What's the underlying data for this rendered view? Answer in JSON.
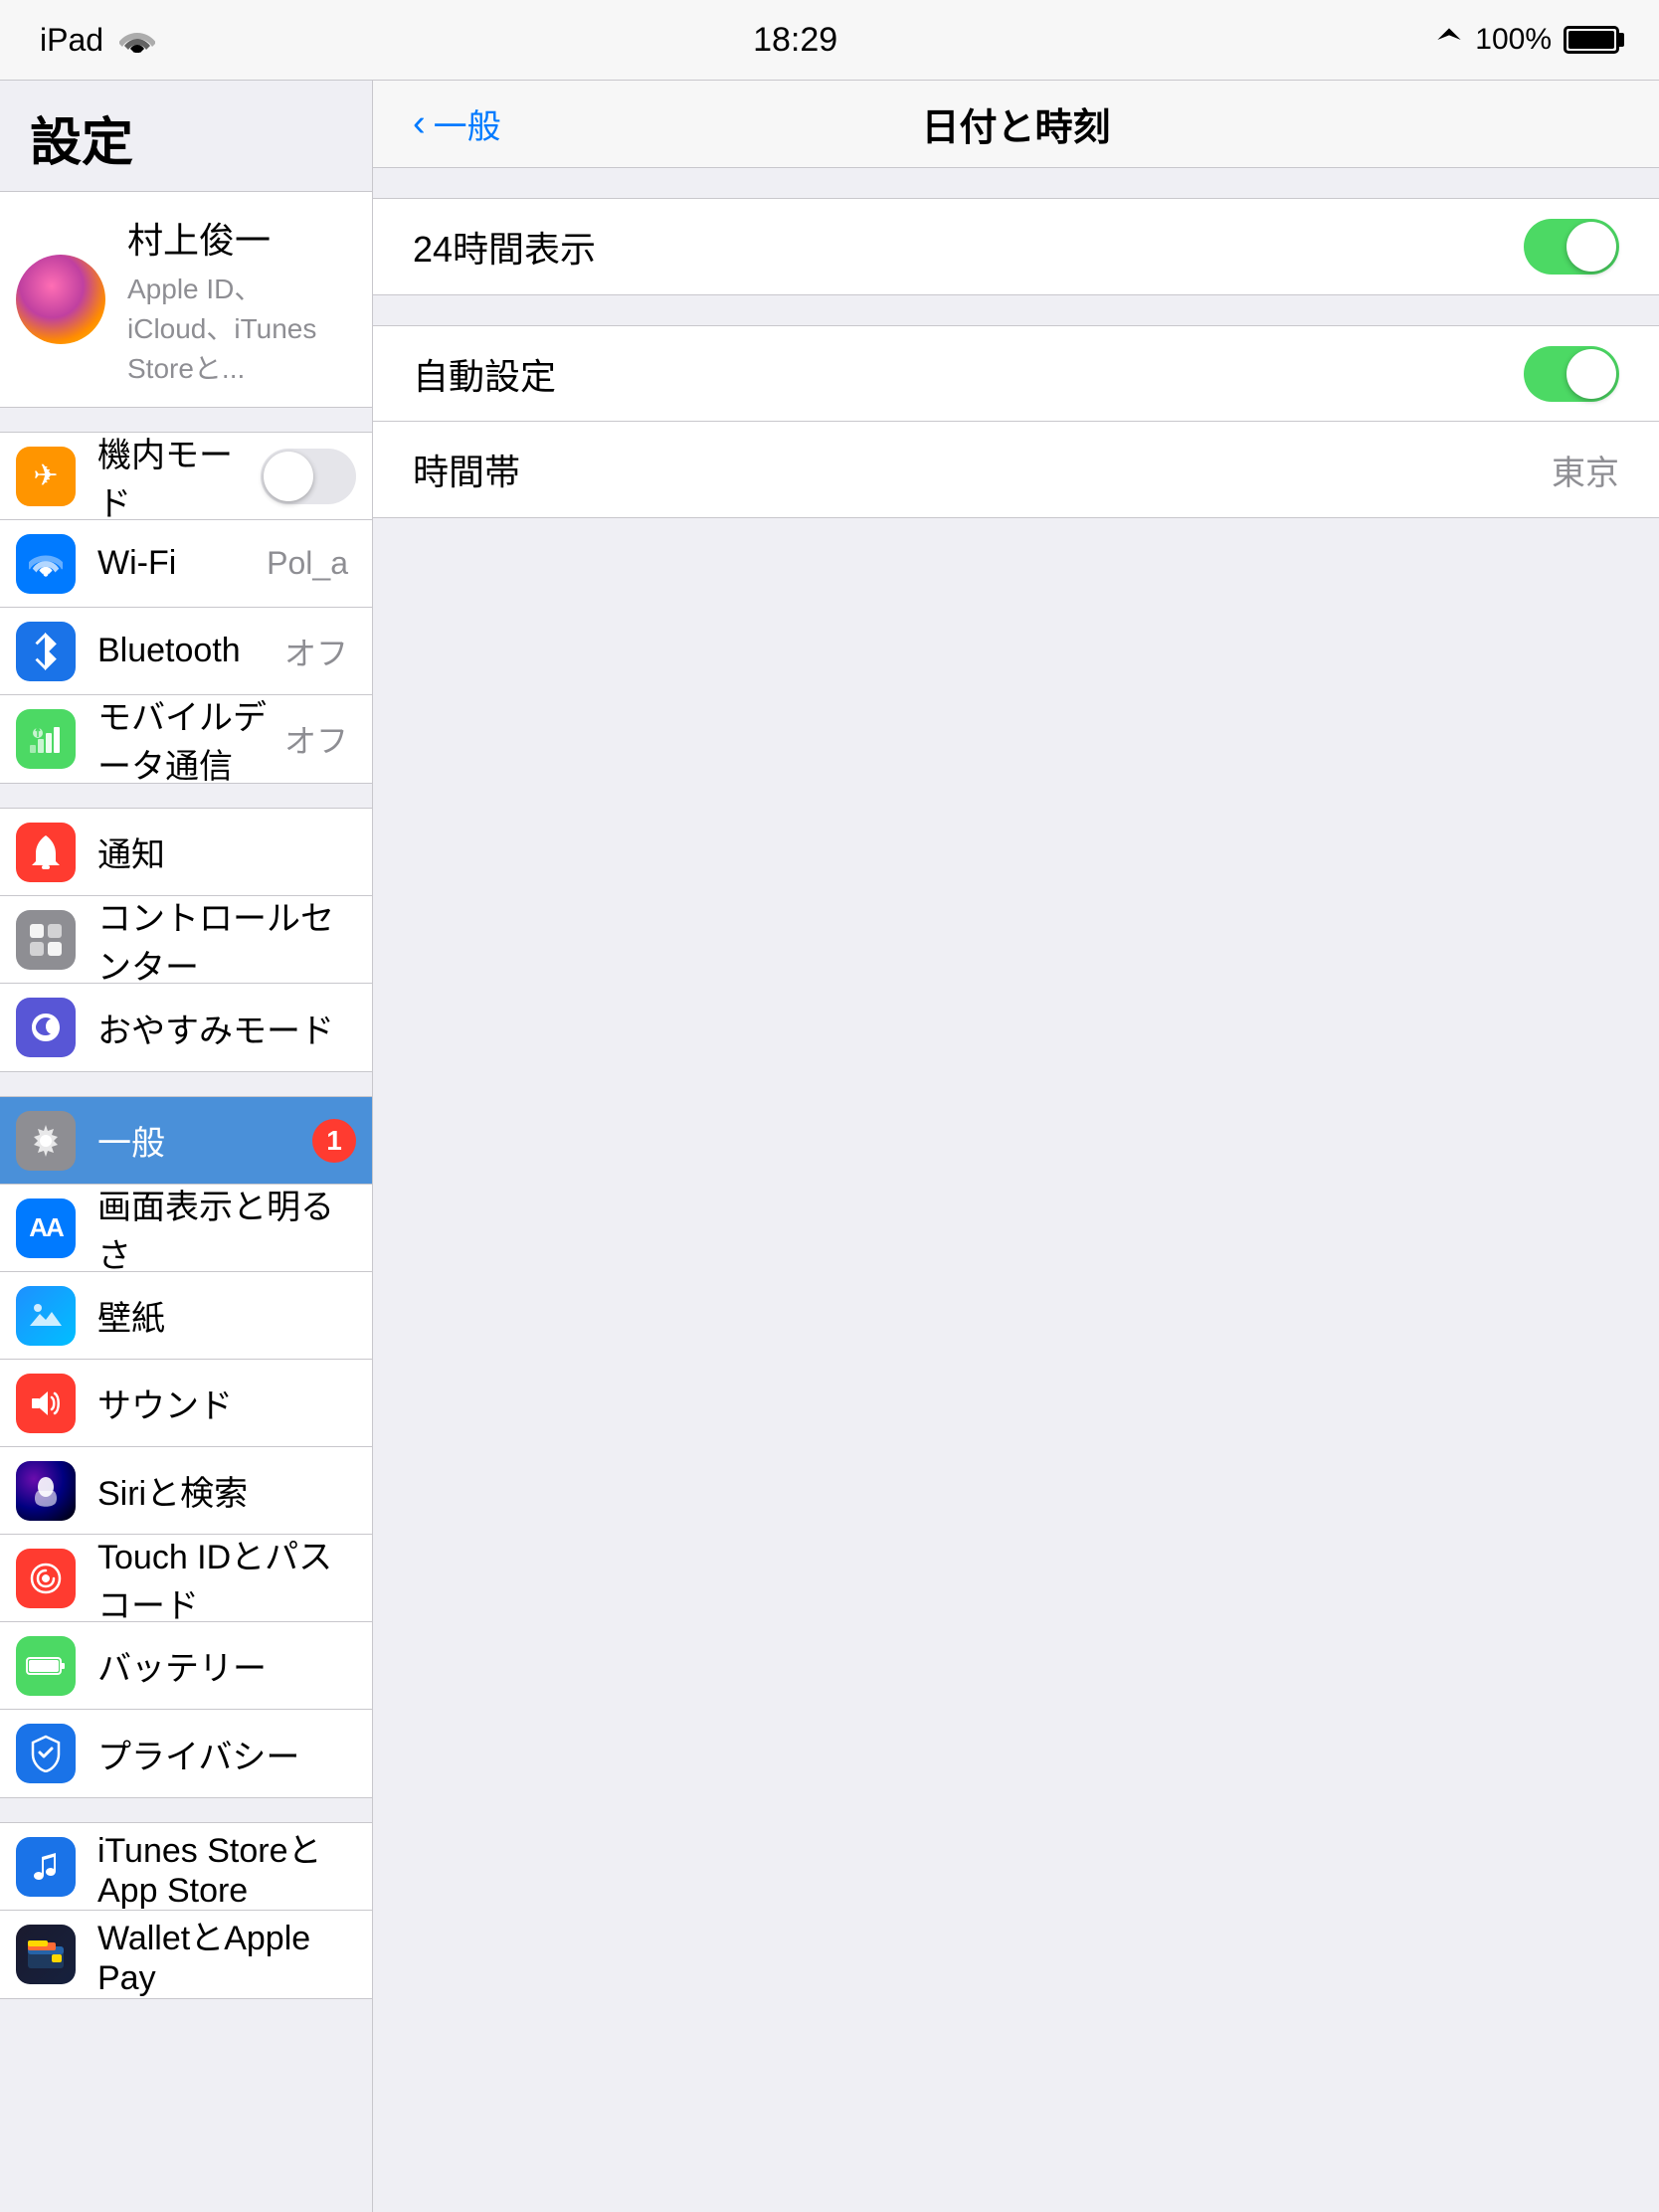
{
  "statusBar": {
    "left": "iPad",
    "time": "18:29",
    "battery": "100%"
  },
  "sidebar": {
    "title": "設定",
    "profile": {
      "name": "村上俊一",
      "sub": "Apple ID、iCloud、iTunes Storeと..."
    },
    "groups": [
      {
        "id": "network",
        "items": [
          {
            "id": "airplane",
            "label": "機内モード",
            "icon": "✈",
            "iconClass": "icon-orange",
            "value": "",
            "hasToggle": true,
            "toggleOn": false
          },
          {
            "id": "wifi",
            "label": "Wi-Fi",
            "icon": "wifi",
            "iconClass": "icon-blue",
            "value": "Pol_a",
            "hasToggle": false
          },
          {
            "id": "bluetooth",
            "label": "Bluetooth",
            "icon": "bluetooth",
            "iconClass": "icon-blue-dark",
            "value": "オフ",
            "hasToggle": false
          },
          {
            "id": "cellular",
            "label": "モバイルデータ通信",
            "icon": "cellular",
            "iconClass": "icon-green",
            "value": "オフ",
            "hasToggle": false
          }
        ]
      },
      {
        "id": "system",
        "items": [
          {
            "id": "notification",
            "label": "通知",
            "icon": "🔔",
            "iconClass": "icon-red",
            "value": "",
            "hasToggle": false
          },
          {
            "id": "controlcenter",
            "label": "コントロールセンター",
            "icon": "⊞",
            "iconClass": "icon-gray",
            "value": "",
            "hasToggle": false
          },
          {
            "id": "donotdisturb",
            "label": "おやすみモード",
            "icon": "🌙",
            "iconClass": "icon-purple",
            "value": "",
            "hasToggle": false
          }
        ]
      },
      {
        "id": "general",
        "items": [
          {
            "id": "general-item",
            "label": "一般",
            "icon": "⚙",
            "iconClass": "icon-gray",
            "value": "",
            "badge": "1",
            "active": true
          },
          {
            "id": "display",
            "label": "画面表示と明るさ",
            "icon": "AA",
            "iconClass": "icon-aa",
            "value": "",
            "hasToggle": false
          },
          {
            "id": "wallpaper",
            "label": "壁紙",
            "icon": "❋",
            "iconClass": "icon-wallpaper",
            "value": "",
            "hasToggle": false
          },
          {
            "id": "sound",
            "label": "サウンド",
            "icon": "🔊",
            "iconClass": "icon-sound",
            "value": "",
            "hasToggle": false
          },
          {
            "id": "siri",
            "label": "Siriと検索",
            "icon": "siri",
            "iconClass": "icon-siri",
            "value": "",
            "hasToggle": false
          },
          {
            "id": "touchid",
            "label": "Touch IDとパスコード",
            "icon": "fingerprint",
            "iconClass": "icon-touchid",
            "value": "",
            "hasToggle": false
          },
          {
            "id": "battery",
            "label": "バッテリー",
            "icon": "battery",
            "iconClass": "icon-battery",
            "value": "",
            "hasToggle": false
          },
          {
            "id": "privacy",
            "label": "プライバシー",
            "icon": "hand",
            "iconClass": "icon-privacy",
            "value": "",
            "hasToggle": false
          }
        ]
      },
      {
        "id": "apps",
        "items": [
          {
            "id": "itunes",
            "label": "iTunes StoreとApp Store",
            "icon": "A",
            "iconClass": "icon-itunes",
            "value": "",
            "hasToggle": false
          },
          {
            "id": "wallet",
            "label": "WalletとApple Pay",
            "icon": "wallet",
            "iconClass": "icon-wallet",
            "value": "",
            "hasToggle": false
          }
        ]
      }
    ]
  },
  "rightPanel": {
    "backLabel": "一般",
    "title": "日付と時刻",
    "groups": [
      {
        "id": "time-format",
        "rows": [
          {
            "id": "24h",
            "label": "24時間表示",
            "toggleOn": true
          }
        ]
      },
      {
        "id": "auto-time",
        "rows": [
          {
            "id": "auto-set",
            "label": "自動設定",
            "toggleOn": true
          },
          {
            "id": "timezone",
            "label": "時間帯",
            "value": "東京"
          }
        ]
      }
    ]
  }
}
